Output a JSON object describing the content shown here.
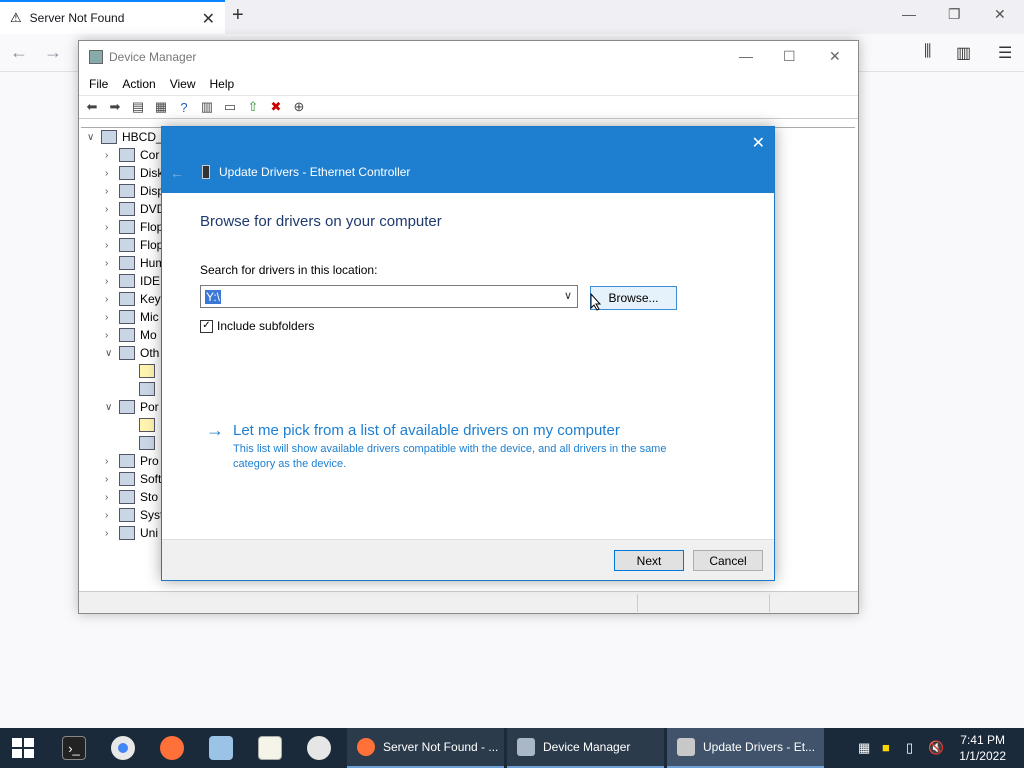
{
  "browser": {
    "tab_title": "Server Not Found",
    "tab_close": "✕",
    "new_tab": "+"
  },
  "device_manager": {
    "title": "Device Manager",
    "menu": [
      "File",
      "Action",
      "View",
      "Help"
    ],
    "tree_root": "HBCD_",
    "tree_items": [
      "Cor",
      "Disk",
      "Disp",
      "DVD",
      "Flop",
      "Flop",
      "Hum",
      "IDE",
      "Key",
      "Mic",
      "Mo",
      "Oth",
      "",
      "",
      "Por",
      "",
      "",
      "Pro",
      "Soft",
      "Sto",
      "Syst",
      "Uni"
    ]
  },
  "dialog": {
    "header_title": "Update Drivers - Ethernet Controller",
    "heading": "Browse for drivers on your computer",
    "search_label": "Search for drivers in this location:",
    "path_value": "Y:\\",
    "browse_label": "Browse...",
    "include_subfolders_label": "Include subfolders",
    "include_subfolders_checked": true,
    "pick_title": "Let me pick from a list of available drivers on my computer",
    "pick_desc": "This list will show available drivers compatible with the device, and all drivers in the same category as the device.",
    "next_label": "Next",
    "cancel_label": "Cancel",
    "accent_color": "#1e7fd0"
  },
  "taskbar": {
    "tasks": [
      {
        "label": "Server Not Found - ..."
      },
      {
        "label": "Device Manager"
      },
      {
        "label": "Update Drivers - Et..."
      }
    ],
    "time": "7:41 PM",
    "date": "1/1/2022"
  }
}
